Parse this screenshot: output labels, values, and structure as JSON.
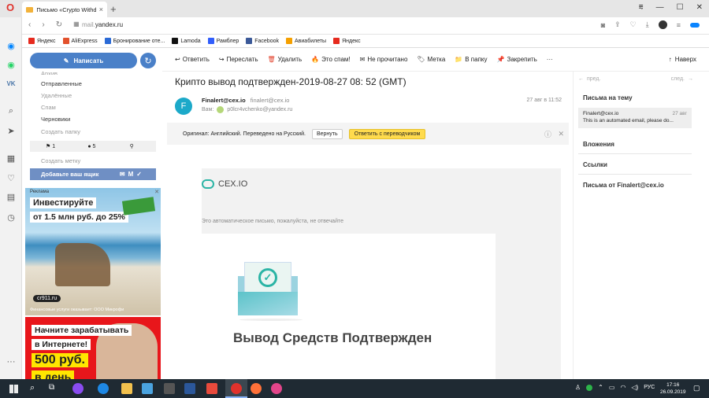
{
  "browser": {
    "tab_title": "Письмо «Crypto Withdraw",
    "new_tab_label": "+",
    "url_prefix": "mail.",
    "url_host": "yandex.ru",
    "opera_logo": "O",
    "accent": "#e0322c"
  },
  "bookmarks": [
    {
      "label": "Яндекс",
      "color": "#e62a1e"
    },
    {
      "label": "AliExpress",
      "color": "#e2512c"
    },
    {
      "label": "Бронирование оте...",
      "color": "#2a6ad6"
    },
    {
      "label": "Lamoda",
      "color": "#111111"
    },
    {
      "label": "Рамблер",
      "color": "#315efb"
    },
    {
      "label": "Facebook",
      "color": "#3b5998"
    },
    {
      "label": "Авиабилеты",
      "color": "#f5a000"
    },
    {
      "label": "Яндекс",
      "color": "#e62a1e"
    }
  ],
  "mail": {
    "compose_label": "Написать",
    "folders": [
      "Архив",
      "Отправленные",
      "Удалённые",
      "Спам",
      "Черновики"
    ],
    "create_folder": "Создать папку",
    "counters": [
      {
        "icon": "flag-icon",
        "value": "1"
      },
      {
        "icon": "dot-icon",
        "value": "5"
      },
      {
        "icon": "clip-icon",
        "value": ""
      }
    ],
    "create_label": "Создать метку",
    "add_mailbox": "Добавьте ваш ящик",
    "ads": [
      {
        "tag": "Реклама",
        "headline1": "Инвестируйте",
        "headline2": "от 1.5 млн руб. до 25%",
        "domain": "cr911.ru",
        "disclaimer": "Финансовые услуги оказывает: ООО Микрофи"
      },
      {
        "headline1": "Начните зарабатывать",
        "headline2": "в Интернете!",
        "price": "500 руб.",
        "sub": "в день"
      }
    ]
  },
  "toolbar": {
    "items": [
      {
        "icon": "reply-icon",
        "label": "Ответить"
      },
      {
        "icon": "forward-icon",
        "label": "Переслать"
      },
      {
        "icon": "trash-icon",
        "label": "Удалить"
      },
      {
        "icon": "spam-icon",
        "label": "Это спам!"
      },
      {
        "icon": "unread-icon",
        "label": "Не прочитано"
      },
      {
        "icon": "label-icon",
        "label": "Метка"
      },
      {
        "icon": "folder-icon",
        "label": "В папку"
      },
      {
        "icon": "pin-icon",
        "label": "Закрепить"
      },
      {
        "icon": "more-icon",
        "label": "···"
      }
    ],
    "up_label": "Наверх"
  },
  "message": {
    "subject": "Крипто вывод подтвержден-2019-08-27 08: 52 (GMT)",
    "avatar_letter": "F",
    "sender_name": "Finalert@cex.io",
    "sender_email": "finalert@cex.io",
    "to_label": "Вам:",
    "to_email": "p0lcr4vchenko@yandex.ru",
    "date": "27 авг в 11:52",
    "translate_text": "Оригинал: Английский. Переведено на Русский.",
    "revert_button": "Вернуть",
    "show_translation_button": "Ответить с переводчиком",
    "body_logo": "CEX.IO",
    "autoreply_note": "Это автоматическое письмо, пожалуйста, не отвечайте",
    "body_heading": "Вывод Средств Подтвержден"
  },
  "right_panel": {
    "prev": "пред.",
    "next": "след.",
    "thread_title": "Письма на тему",
    "thread_item": {
      "from": "Finalert@cex.io",
      "date": "27 авг",
      "snippet": "This is an automated email, please do..."
    },
    "sections": [
      "Вложения",
      "Ссылки",
      "Письма от Finalert@cex.io"
    ]
  },
  "taskbar": {
    "lang": "РУС",
    "time": "17:16",
    "date": "26.09.2019"
  }
}
